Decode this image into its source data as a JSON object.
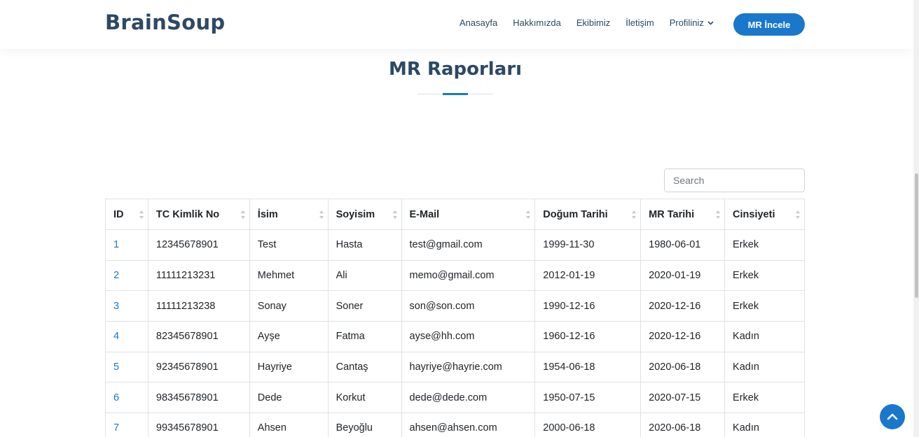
{
  "header": {
    "logo": "BrainSoup",
    "nav": [
      "Anasayfa",
      "Hakkımızda",
      "Ekibimiz",
      "İletişim"
    ],
    "profile_label": "Profiliniz",
    "cta_label": "MR İncele"
  },
  "page": {
    "title": "MR Raporları"
  },
  "search": {
    "placeholder": "Search",
    "value": ""
  },
  "table": {
    "columns": [
      "ID",
      "TC Kimlik No",
      "İsim",
      "Soyisim",
      "E-Mail",
      "Doğum Tarihi",
      "MR Tarihi",
      "Cinsiyeti"
    ],
    "rows": [
      [
        "1",
        "12345678901",
        "Test",
        "Hasta",
        "test@gmail.com",
        "1999-11-30",
        "1980-06-01",
        "Erkek"
      ],
      [
        "2",
        "11111213231",
        "Mehmet",
        "Ali",
        "memo@gmail.com",
        "2012-01-19",
        "2020-01-19",
        "Erkek"
      ],
      [
        "3",
        "11111213238",
        "Sonay",
        "Soner",
        "son@son.com",
        "1990-12-16",
        "2020-12-16",
        "Erkek"
      ],
      [
        "4",
        "82345678901",
        "Ayşe",
        "Fatma",
        "ayse@hh.com",
        "1960-12-16",
        "2020-12-16",
        "Kadın"
      ],
      [
        "5",
        "92345678901",
        "Hayriye",
        "Cantaş",
        "hayriye@hayrie.com",
        "1954-06-18",
        "2020-06-18",
        "Kadın"
      ],
      [
        "6",
        "98345678901",
        "Dede",
        "Korkut",
        "dede@dede.com",
        "1950-07-15",
        "2020-07-15",
        "Erkek"
      ],
      [
        "7",
        "99345678901",
        "Ahsen",
        "Beyoğlu",
        "ahsen@ahsen.com",
        "2000-06-18",
        "2020-06-18",
        "Kadın"
      ]
    ]
  },
  "colors": {
    "primary": "#1977cc",
    "heading": "#2c4964",
    "border": "#dee2e6"
  },
  "icons": {
    "profile_dropdown": "chevron-down-icon",
    "sort": "sort-icon",
    "scroll_top": "chevron-up-icon"
  }
}
